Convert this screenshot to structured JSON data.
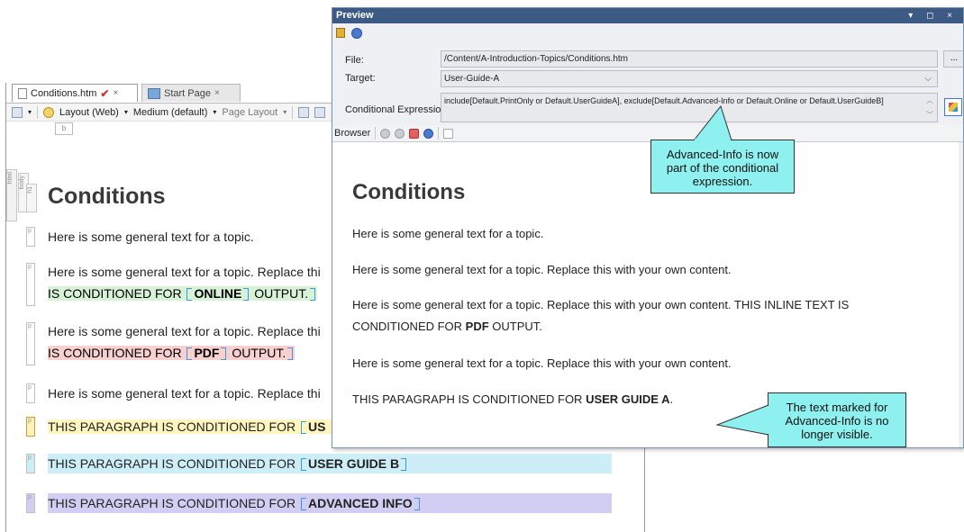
{
  "editor": {
    "tabs": [
      {
        "label": "Conditions.htm",
        "close": "×"
      },
      {
        "label": "Start Page",
        "close": "×"
      }
    ],
    "toolbar": {
      "layout_label": "Layout (Web)",
      "medium_label": "Medium (default)",
      "page_layout_label": "Page Layout",
      "small_box": "b"
    },
    "tag_labels": {
      "html": "html",
      "body": "body",
      "h1": "h1"
    },
    "heading": "Conditions",
    "paragraphs": {
      "p1": "Here is some general text for a topic.",
      "p2_a": "Here is some general text for a topic. Replace thi",
      "p2_b_pre": "IS CONDITIONED FOR ",
      "p2_b_bold": "ONLINE",
      "p2_b_post": " OUTPUT.",
      "p3_a": "Here is some general text for a topic. Replace thi",
      "p3_b_pre": "IS CONDITIONED FOR ",
      "p3_b_bold": "PDF",
      "p3_b_post": " OUTPUT.",
      "p4_a": "Here is some general text for a topic. Replace thi",
      "p5_pre": "THIS PARAGRAPH IS CONDITIONED FOR ",
      "p5_bold": "US",
      "p6_pre": "THIS PARAGRAPH IS CONDITIONED FOR ",
      "p6_bold": "USER GUIDE B",
      "p7_pre": "THIS PARAGRAPH IS CONDITIONED FOR ",
      "p7_bold": "ADVANCED INFO"
    }
  },
  "preview": {
    "title": "Preview",
    "title_controls": "▾ ◻ ×",
    "file_label": "File:",
    "file_value": "/Content/A-Introduction-Topics/Conditions.htm",
    "more_button": "...",
    "target_label": "Target:",
    "target_value": "User-Guide-A",
    "cond_label": "Conditional Expression:",
    "cond_value": "include[Default.PrintOnly or Default.UserGuideA], exclude[Default.Advanced-Info or Default.Online or Default.UserGuideB]",
    "browser_label": "Browser",
    "content": {
      "heading": "Conditions",
      "p1": "Here is some general text for a topic.",
      "p2": "Here is some general text for a topic. Replace this with your own content.",
      "p3_line1": "Here is some general text for a topic. Replace this with your own content. THIS INLINE TEXT IS",
      "p3_line2_pre": "CONDITIONED FOR ",
      "p3_line2_bold": "PDF",
      "p3_line2_post": " OUTPUT.",
      "p4": "Here is some general text for a topic. Replace this with your own content.",
      "p5_pre": "THIS PARAGRAPH IS CONDITIONED FOR ",
      "p5_bold": "USER GUIDE A",
      "p5_post": "."
    }
  },
  "callouts": {
    "c1": [
      "Advanced-Info is now",
      "part of the conditional",
      "expression."
    ],
    "c2": [
      "The text marked for",
      "Advanced-Info is no",
      "longer visible."
    ]
  },
  "colors": {
    "callout_fill": "#8ff0f0",
    "title_bar": "#3c5a83",
    "online_highlight": "#d7f2d7",
    "pdf_highlight": "#f8d0d0",
    "guide_a_highlight": "#fff6bf",
    "guide_b_highlight": "#cdeef7",
    "advanced_highlight": "#d2cdf2"
  }
}
